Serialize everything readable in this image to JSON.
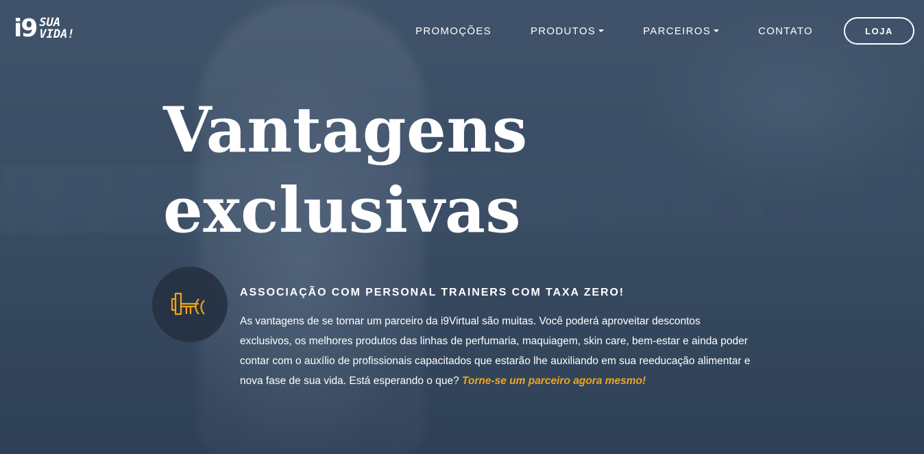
{
  "brand": {
    "logo_main": "i9",
    "logo_line1": "SUA",
    "logo_line2": "VIDA!"
  },
  "nav": {
    "items": [
      {
        "label": "PROMOÇÕES",
        "has_dropdown": false
      },
      {
        "label": "PRODUTOS",
        "has_dropdown": true
      },
      {
        "label": "PARCEIROS",
        "has_dropdown": true
      },
      {
        "label": "CONTATO",
        "has_dropdown": false
      }
    ],
    "cta_label": "LOJA"
  },
  "hero": {
    "title_line1": "Vantagens",
    "title_line2": "exclusivas"
  },
  "feature": {
    "icon": "dumbbell-icon",
    "title": "ASSOCIAÇÃO COM PERSONAL TRAINERS COM TAXA ZERO!",
    "body": "As vantagens de se tornar um parceiro da i9Virtual são muitas. Você poderá aproveitar descontos exclusivos, os melhores produtos das linhas de perfumaria, maquiagem, skin care, bem-estar e ainda poder contar com o auxílio de profissionais capacitados que estarão lhe auxiliando em sua reeducação alimentar e nova fase de sua vida. Está esperando o que? ",
    "link_text": "Torne-se um parceiro agora mesmo!"
  },
  "colors": {
    "accent": "#f0a51c",
    "background": "#3a4c62",
    "text": "#ffffff"
  }
}
